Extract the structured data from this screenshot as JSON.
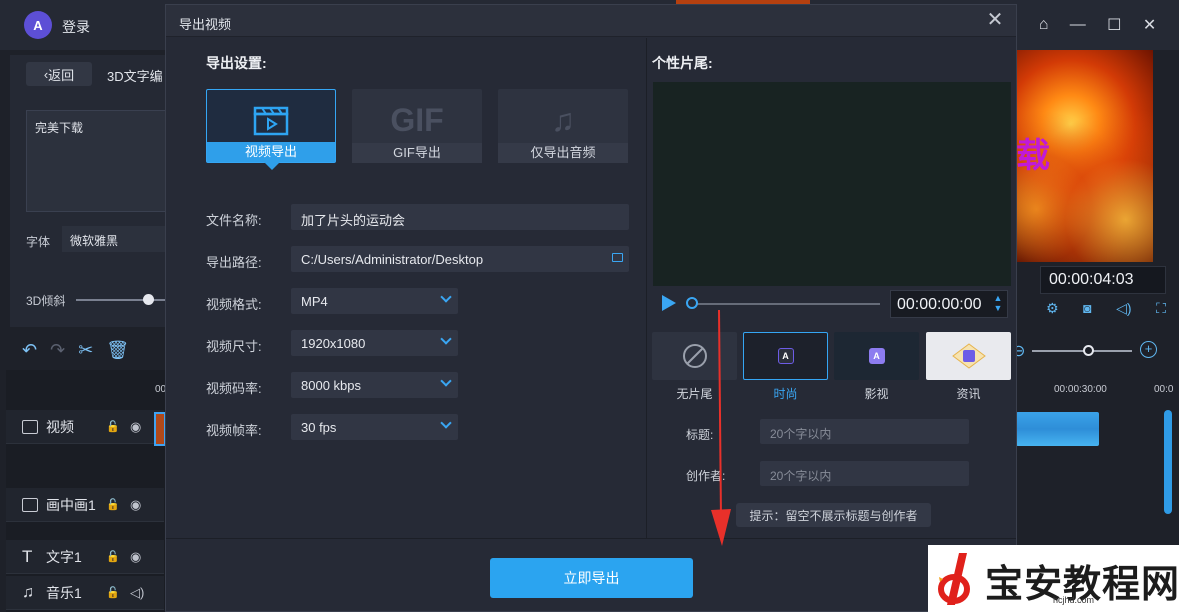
{
  "app": {
    "login_label": "登录",
    "back_label": "返回",
    "tab_3d_label": "3D文字编",
    "text_content": "完美下载",
    "font_label": "字体",
    "font_value": "微软雅黑",
    "tilt_label": "3D倾斜",
    "timeline_tick": "00",
    "tracks": [
      {
        "label": "视频"
      },
      {
        "label": "画中画1"
      },
      {
        "label": "文字1"
      },
      {
        "label": "音乐1"
      }
    ],
    "preview_text": "载",
    "right_timecode": "00:00:04:03",
    "ruler_labels": [
      "00:00:30:00",
      "00:0"
    ]
  },
  "modal": {
    "title": "导出视频",
    "close_icon": "close-icon",
    "export_settings_heading": "导出设置:",
    "export_types": [
      {
        "label": "视频导出",
        "icon": "video-export-icon",
        "active": true
      },
      {
        "label": "GIF导出",
        "icon": "gif-icon",
        "icon_text": "GIF",
        "active": false
      },
      {
        "label": "仅导出音频",
        "icon": "music-note-icon",
        "active": false
      }
    ],
    "form": {
      "filename_label": "文件名称:",
      "filename_value": "加了片头的运动会",
      "path_label": "导出路径:",
      "path_value": "C:/Users/Administrator/Desktop",
      "format_label": "视频格式:",
      "format_value": "MP4",
      "size_label": "视频尺寸:",
      "size_value": "1920x1080",
      "bitrate_label": "视频码率:",
      "bitrate_value": "8000 kbps",
      "framerate_label": "视频帧率:",
      "framerate_value": "30 fps"
    },
    "outro_heading": "个性片尾:",
    "player_time": "00:00:00:00",
    "outros": [
      {
        "label": "无片尾",
        "active": false
      },
      {
        "label": "时尚",
        "active": true
      },
      {
        "label": "影视",
        "active": false
      },
      {
        "label": "资讯",
        "active": false
      }
    ],
    "title_label": "标题:",
    "title_placeholder": "20个字以内",
    "author_label": "创作者:",
    "author_placeholder": "20个字以内",
    "hint": "提示：留空不展示标题与创作者",
    "export_button": "立即导出"
  },
  "watermark": {
    "text": "宝安教程网",
    "url": "hcjhd.com"
  },
  "colors": {
    "accent": "#2ba4f0",
    "annotation_arrow": "#e8302a"
  }
}
